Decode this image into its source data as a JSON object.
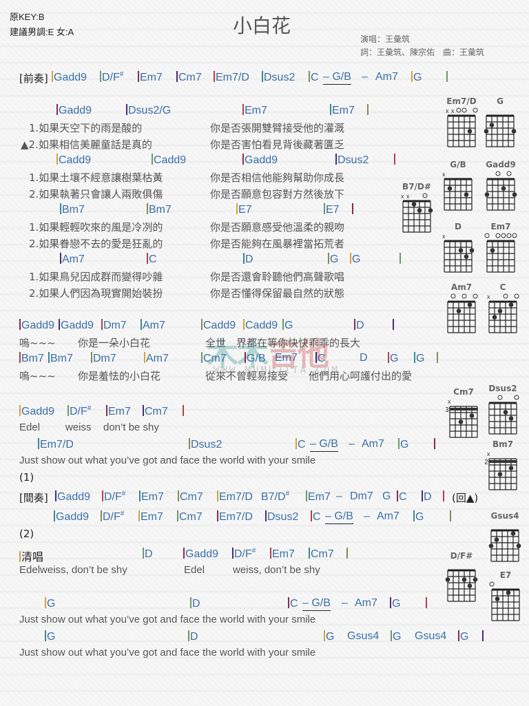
{
  "header": {
    "original_key": "原KEY:B",
    "suggested_key": "建議男調:E 女:A",
    "title": "小白花",
    "singer": "演唱：王彙筑",
    "credits": "詞：王彙筑、陳宗佑　曲：王彙筑"
  },
  "watermark": {
    "text_a": "木木",
    "text_b": "吉他",
    "url": "WWW.MUMUJITA.COM"
  },
  "sections": {
    "prelude_label": "[前奏]",
    "interlude_label": "[間奏]",
    "acapella_label": "清唱",
    "return_mark": "(回▲)",
    "mark_1": "(1)",
    "mark_2": "(2)"
  },
  "rows": {
    "prelude": [
      "Gadd9",
      "D/F#",
      "Em7",
      "Cm7",
      "Em7/D",
      "Dsus2",
      "C",
      "– G/B",
      "–",
      "Am7",
      "G"
    ],
    "v_chords_1": [
      "Gadd9",
      "Dsus2/G",
      "Em7",
      "Em7"
    ],
    "v_lyric_1a": [
      "1.如果天空下的雨是酸的",
      "你是否張開雙臂接受他的灌溉"
    ],
    "v_lyric_1b": [
      "▲2.如果相信美麗童話是真的",
      "你是否害怕看見背後藏著匱乏"
    ],
    "v_chords_2": [
      "Cadd9",
      "Cadd9",
      "Gadd9",
      "Dsus2"
    ],
    "v_lyric_2a": [
      "1.如果土壤不經意讓樹葉枯黃",
      "你是否相信他能夠幫助你成長"
    ],
    "v_lyric_2b": [
      "2.如果執著只會讓人兩敗俱傷",
      "你是否願意包容對方然後放下"
    ],
    "v_chords_3": [
      "Bm7",
      "Bm7",
      "E7",
      "E7"
    ],
    "v_lyric_3a": [
      "1.如果輕輕吹來的風是冷冽的",
      "你是否願意感受他溫柔的親吻"
    ],
    "v_lyric_3b": [
      "2.如果眷戀不去的愛是狂亂的",
      "你是否能夠在風暴裡當拓荒者"
    ],
    "v_chords_4": [
      "Am7",
      "C",
      "D",
      "G",
      "G"
    ],
    "v_lyric_4a": [
      "1.如果鳥兒因成群而變得吵雜",
      "你是否還會聆聽他們高聲歌唱"
    ],
    "v_lyric_4b": [
      "2.如果人們因為現實開始裝扮",
      "你是否懂得保留最自然的狀態"
    ],
    "c_chords_1": [
      "Gadd9",
      "Gadd9",
      "Dm7",
      "Am7",
      "Cadd9",
      "Cadd9",
      "G",
      "D"
    ],
    "c_lyric_1": [
      "嗚~~~",
      "你是一朵小白花",
      "全世　界都在等你快快乖乖的長大"
    ],
    "c_chords_2": [
      "Bm7",
      "Bm7",
      "Dm7",
      "Am7",
      "Cm7",
      "G/B",
      "Em7",
      "C",
      "D",
      "G",
      "G"
    ],
    "c_lyric_2": [
      "嗚~~~",
      "你是羞怯的小白花",
      "從來不曾輕易接受",
      "他們用心呵護付出的愛"
    ],
    "e_chords_1": [
      "Gadd9",
      "D/F#",
      "Em7",
      "Cm7"
    ],
    "e_lyric_1": [
      "Edel",
      "weiss",
      "don’t be shy"
    ],
    "e_chords_2": [
      "Em7/D",
      "Dsus2",
      "C",
      "– G/B",
      "–",
      "Am7",
      "G"
    ],
    "e_lyric_2": "Just show out what you’ve got and face the world with your smile",
    "i_chords_1": [
      "Gadd9",
      "D/F#",
      "Em7",
      "Cm7",
      "Em7/D",
      "B7/D#",
      "Em7",
      "–",
      "Dm7",
      "G",
      "C",
      "D"
    ],
    "i_chords_2": [
      "Gadd9",
      "D/F#",
      "Em7",
      "Cm7",
      "Em7/D",
      "Dsus2",
      "C",
      "– G/B",
      "–",
      "Am7",
      "G"
    ],
    "a_chords_1": [
      "D",
      "Gadd9",
      "D/F#",
      "Em7",
      "Cm7"
    ],
    "a_lyric_1": [
      "Edelweiss, don’t be shy",
      "Edel",
      "weiss, don’t be shy"
    ],
    "a_chords_2": [
      "G",
      "D",
      "C",
      "– G/B",
      "–",
      "Am7",
      "G"
    ],
    "a_lyric_2": "Just show out what you’ve got and face the world with your smile",
    "a_chords_3": [
      "G",
      "D",
      "G",
      "Gsus4",
      "G",
      "Gsus4",
      "G"
    ],
    "a_lyric_3": "Just show out what you’ve got and face the world with your smile"
  },
  "diagrams": [
    {
      "name": "Em7/D",
      "marks": "xxoo_o",
      "fret": "",
      "dots": [
        [
          5,
          3
        ]
      ],
      "barre": null
    },
    {
      "name": "G",
      "marks": "",
      "fret": "",
      "dots": [
        [
          2,
          2
        ],
        [
          1,
          3
        ],
        [
          6,
          3
        ]
      ],
      "barre": null
    },
    {
      "name": "G/B",
      "marks": "x",
      "fret": "",
      "dots": [
        [
          2,
          2
        ],
        [
          5,
          3
        ]
      ],
      "barre": null
    },
    {
      "name": "Gadd9",
      "marks": "__o_o_",
      "fret": "",
      "dots": [
        [
          4,
          2
        ],
        [
          1,
          3
        ],
        [
          6,
          3
        ]
      ],
      "barre": null
    },
    {
      "name": "B7/D#",
      "marks": "xx__o_",
      "fret": "",
      "dots": [
        [
          3,
          1
        ],
        [
          4,
          2
        ],
        [
          6,
          2
        ]
      ],
      "barre": null
    },
    {
      "name": "D",
      "marks": "x",
      "fret": "",
      "dots": [
        [
          4,
          2
        ],
        [
          6,
          2
        ],
        [
          5,
          3
        ]
      ],
      "barre": null
    },
    {
      "name": "Em7",
      "marks": "o_oooo",
      "fret": "",
      "dots": [
        [
          2,
          2
        ]
      ],
      "barre": null
    },
    {
      "name": "Am7",
      "marks": "_o_o_o",
      "fret": "",
      "dots": [
        [
          5,
          1
        ],
        [
          3,
          2
        ]
      ],
      "barre": null
    },
    {
      "name": "C",
      "marks": "x__o_o",
      "fret": "",
      "dots": [
        [
          5,
          1
        ],
        [
          3,
          2
        ],
        [
          2,
          3
        ]
      ],
      "barre": null
    },
    {
      "name": "Cm7",
      "marks": "x",
      "fret": "3",
      "dots": [
        [
          5,
          2
        ],
        [
          3,
          3
        ]
      ],
      "barre": 1
    },
    {
      "name": "Dsus2",
      "marks": "__o__o",
      "fret": "",
      "dots": [
        [
          4,
          2
        ],
        [
          5,
          3
        ]
      ],
      "barre": null
    },
    {
      "name": "Bm7",
      "marks": "x",
      "fret": "2",
      "dots": [
        [
          5,
          2
        ],
        [
          3,
          3
        ]
      ],
      "barre": 1
    },
    {
      "name": "Gsus4",
      "marks": "",
      "fret": "",
      "dots": [
        [
          5,
          1
        ],
        [
          2,
          2
        ],
        [
          1,
          3
        ],
        [
          6,
          3
        ]
      ],
      "barre": null
    },
    {
      "name": "D/F#",
      "marks": "",
      "fret": "",
      "dots": [
        [
          1,
          2
        ],
        [
          4,
          2
        ],
        [
          6,
          2
        ],
        [
          5,
          3
        ]
      ],
      "barre": null
    },
    {
      "name": "E7",
      "marks": "o",
      "fret": "",
      "dots": [
        [
          4,
          1
        ],
        [
          2,
          2
        ]
      ],
      "barre": null
    }
  ]
}
